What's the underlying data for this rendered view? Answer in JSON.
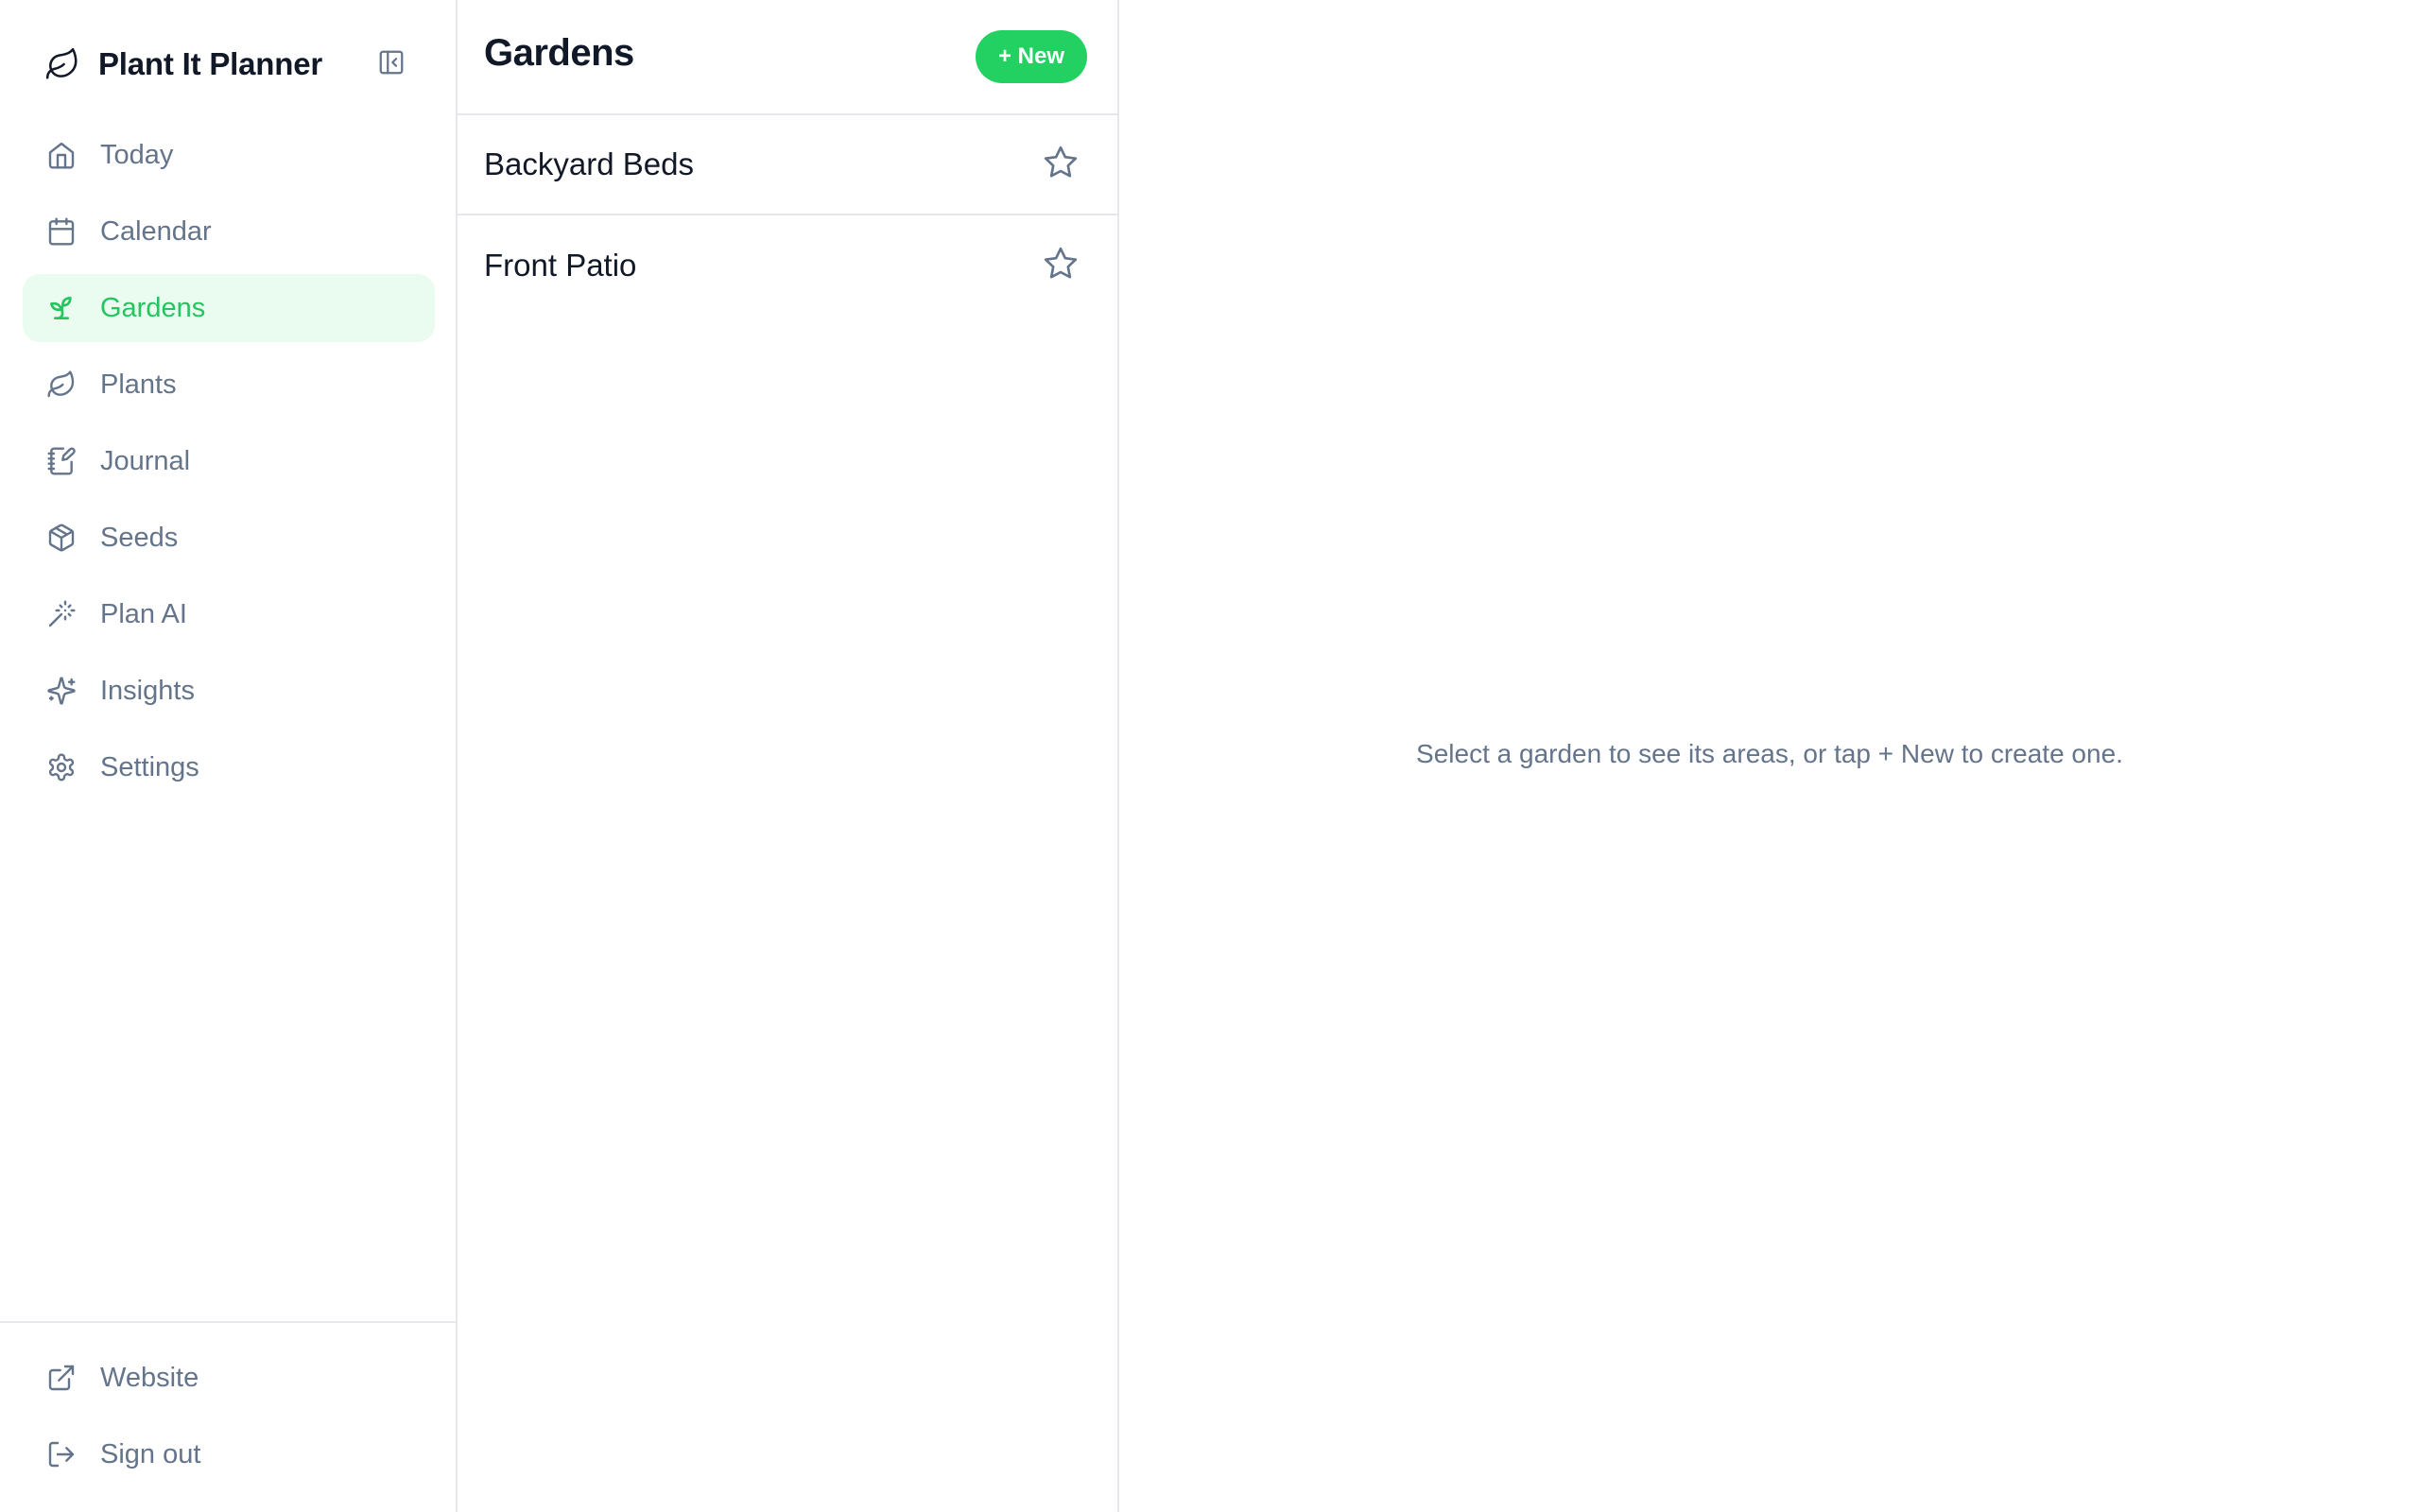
{
  "app": {
    "title": "Plant It Planner",
    "logo_icon": "leaf-icon",
    "collapse_icon": "panel-collapse-icon"
  },
  "colors": {
    "accent": "#22d162",
    "accent_text": "#22c55e",
    "active_bg": "#eafbef",
    "muted_text": "#64748b",
    "border": "#e5e7eb"
  },
  "sidebar": {
    "items": [
      {
        "label": "Today",
        "icon": "home-icon",
        "active": false
      },
      {
        "label": "Calendar",
        "icon": "calendar-icon",
        "active": false
      },
      {
        "label": "Gardens",
        "icon": "sprout-icon",
        "active": true
      },
      {
        "label": "Plants",
        "icon": "leaf-icon",
        "active": false
      },
      {
        "label": "Journal",
        "icon": "notebook-pen-icon",
        "active": false
      },
      {
        "label": "Seeds",
        "icon": "package-icon",
        "active": false
      },
      {
        "label": "Plan AI",
        "icon": "magic-wand-icon",
        "active": false
      },
      {
        "label": "Insights",
        "icon": "sparkles-icon",
        "active": false
      },
      {
        "label": "Settings",
        "icon": "gear-icon",
        "active": false
      }
    ],
    "footer": [
      {
        "label": "Website",
        "icon": "external-link-icon"
      },
      {
        "label": "Sign out",
        "icon": "log-out-icon"
      }
    ]
  },
  "gardens": {
    "title": "Gardens",
    "new_label": "+ New",
    "items": [
      {
        "name": "Backyard Beds",
        "favorite": false
      },
      {
        "name": "Front Patio",
        "favorite": false
      }
    ]
  },
  "detail": {
    "empty_message": "Select a garden to see its areas, or tap + New to create one."
  }
}
